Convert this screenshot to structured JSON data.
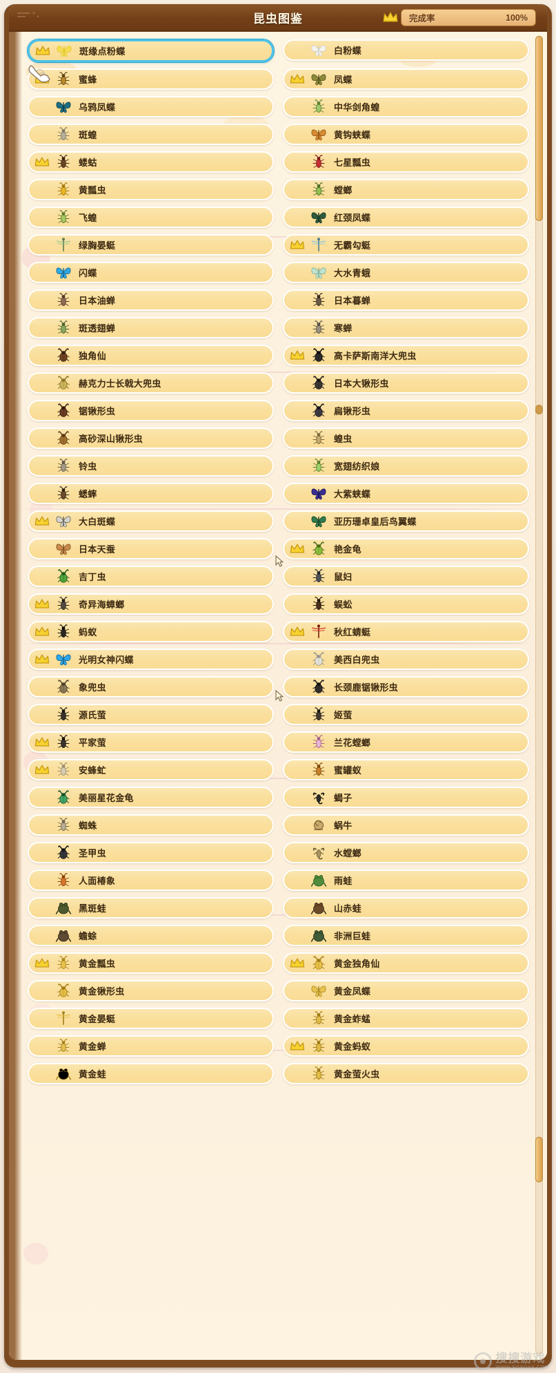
{
  "header": {
    "title": "昆虫图鉴",
    "crown_icon": "crown-icon",
    "completion_label": "完成率",
    "completion_value": "100%"
  },
  "scrollbar": {
    "name": "vertical-scrollbar"
  },
  "watermark": {
    "main": "搜搜游戏",
    "sub": "WWW.SOSOYX.COM"
  },
  "colors": {
    "frame_wood": "#7c4a21",
    "titlebar": "#733f18",
    "row_fill": "#fadf9c",
    "row_border": "#ffffff",
    "selected_outline": "#4fc3e8",
    "crown_gold": "#f5d02e",
    "text": "#3d2a12",
    "pill_fill": "#eeba7c"
  },
  "list": {
    "name": "insect-encyclopedia-list",
    "columns": 2,
    "items": [
      {
        "name": "斑缘点粉蝶",
        "crown": true,
        "selected": true,
        "icon": "butterfly-yellow",
        "col": 0
      },
      {
        "name": "白粉蝶",
        "crown": false,
        "selected": false,
        "icon": "butterfly-white",
        "col": 1
      },
      {
        "name": "蜜蜂",
        "crown": true,
        "selected": false,
        "icon": "bee",
        "col": 0
      },
      {
        "name": "凤蝶",
        "crown": true,
        "selected": false,
        "icon": "butterfly-olive",
        "col": 1
      },
      {
        "name": "乌鸦凤蝶",
        "crown": false,
        "selected": false,
        "icon": "butterfly-teal",
        "col": 0
      },
      {
        "name": "中华剑角蝗",
        "crown": false,
        "selected": false,
        "icon": "grasshopper-green",
        "col": 1
      },
      {
        "name": "斑蝗",
        "crown": false,
        "selected": false,
        "icon": "grasshopper-grey",
        "col": 0
      },
      {
        "name": "黄钩蛱蝶",
        "crown": false,
        "selected": false,
        "icon": "butterfly-orange",
        "col": 1
      },
      {
        "name": "蝼蛄",
        "crown": true,
        "selected": false,
        "icon": "mole-cricket",
        "col": 0
      },
      {
        "name": "七星瓢虫",
        "crown": false,
        "selected": false,
        "icon": "ladybug-red",
        "col": 1
      },
      {
        "name": "黄瓢虫",
        "crown": false,
        "selected": false,
        "icon": "ladybug-yellow",
        "col": 0
      },
      {
        "name": "螳螂",
        "crown": false,
        "selected": false,
        "icon": "mantis-green",
        "col": 1
      },
      {
        "name": "飞蝗",
        "crown": false,
        "selected": false,
        "icon": "locust-green",
        "col": 0
      },
      {
        "name": "红颈凤蝶",
        "crown": false,
        "selected": false,
        "icon": "butterfly-darkgreen",
        "col": 1
      },
      {
        "name": "绿胸晏蜓",
        "crown": false,
        "selected": false,
        "icon": "dragonfly-green",
        "col": 0
      },
      {
        "name": "无霸勾蜓",
        "crown": true,
        "selected": false,
        "icon": "dragonfly-blue",
        "col": 1
      },
      {
        "name": "闪蝶",
        "crown": false,
        "selected": false,
        "icon": "morpho-blue",
        "col": 0
      },
      {
        "name": "大水青蛾",
        "crown": false,
        "selected": false,
        "icon": "moth-pale-green",
        "col": 1
      },
      {
        "name": "日本油蝉",
        "crown": false,
        "selected": false,
        "icon": "cicada-brown",
        "col": 0
      },
      {
        "name": "日本暮蝉",
        "crown": false,
        "selected": false,
        "icon": "cicada-dark",
        "col": 1
      },
      {
        "name": "斑透翅蝉",
        "crown": false,
        "selected": false,
        "icon": "cicada-green",
        "col": 0
      },
      {
        "name": "寒蝉",
        "crown": false,
        "selected": false,
        "icon": "cicada-grey",
        "col": 1
      },
      {
        "name": "独角仙",
        "crown": false,
        "selected": false,
        "icon": "rhino-beetle",
        "col": 0
      },
      {
        "name": "高卡萨斯南洋大兜虫",
        "crown": true,
        "selected": false,
        "icon": "atlas-beetle",
        "col": 1
      },
      {
        "name": "赫克力士长戟大兜虫",
        "crown": false,
        "selected": false,
        "icon": "hercules-beetle",
        "col": 0
      },
      {
        "name": "日本大锹形虫",
        "crown": false,
        "selected": false,
        "icon": "stag-beetle-dark",
        "col": 1
      },
      {
        "name": "锯锹形虫",
        "crown": false,
        "selected": false,
        "icon": "saw-stag-beetle",
        "col": 0
      },
      {
        "name": "扁锹形虫",
        "crown": false,
        "selected": false,
        "icon": "flat-stag-beetle",
        "col": 1
      },
      {
        "name": "高砂深山锹形虫",
        "crown": false,
        "selected": false,
        "icon": "miyama-stag",
        "col": 0
      },
      {
        "name": "蝗虫",
        "crown": false,
        "selected": false,
        "icon": "locust-tan",
        "col": 1
      },
      {
        "name": "铃虫",
        "crown": false,
        "selected": false,
        "icon": "bell-cricket",
        "col": 0
      },
      {
        "name": "宽翅纺织娘",
        "crown": false,
        "selected": false,
        "icon": "katydid-green",
        "col": 1
      },
      {
        "name": "蟋蟀",
        "crown": false,
        "selected": false,
        "icon": "cricket-brown",
        "col": 0
      },
      {
        "name": "大紫蛱蝶",
        "crown": false,
        "selected": false,
        "icon": "butterfly-purple",
        "col": 1
      },
      {
        "name": "大白斑蝶",
        "crown": true,
        "selected": false,
        "icon": "butterfly-speckled",
        "col": 0
      },
      {
        "name": "亚历珊卓皇后鸟翼蝶",
        "crown": false,
        "selected": false,
        "icon": "birdwing-green",
        "col": 1
      },
      {
        "name": "日本天蚕",
        "crown": false,
        "selected": false,
        "icon": "moth-tan",
        "col": 0
      },
      {
        "name": "艳金龟",
        "crown": true,
        "selected": false,
        "icon": "scarab-green",
        "col": 1
      },
      {
        "name": "吉丁虫",
        "crown": false,
        "selected": false,
        "icon": "jewel-beetle",
        "col": 0
      },
      {
        "name": "鼠妇",
        "crown": false,
        "selected": false,
        "icon": "pillbug",
        "col": 1
      },
      {
        "name": "奇异海蟑螂",
        "crown": true,
        "selected": false,
        "icon": "sea-roach",
        "col": 0
      },
      {
        "name": "蜈蚣",
        "crown": false,
        "selected": false,
        "icon": "centipede",
        "col": 1
      },
      {
        "name": "蚂蚁",
        "crown": true,
        "selected": false,
        "icon": "ant-black",
        "col": 0
      },
      {
        "name": "秋红蜻蜓",
        "crown": true,
        "selected": false,
        "icon": "dragonfly-red",
        "col": 1
      },
      {
        "name": "光明女神闪蝶",
        "crown": true,
        "selected": false,
        "icon": "morpho-cyan",
        "col": 0
      },
      {
        "name": "美西白兜虫",
        "crown": false,
        "selected": false,
        "icon": "white-beetle",
        "col": 1
      },
      {
        "name": "象兜虫",
        "crown": false,
        "selected": false,
        "icon": "elephant-beetle",
        "col": 0
      },
      {
        "name": "长颈鹿锯锹形虫",
        "crown": false,
        "selected": false,
        "icon": "giraffe-stag",
        "col": 1
      },
      {
        "name": "源氏萤",
        "crown": false,
        "selected": false,
        "icon": "firefly-genji",
        "col": 0
      },
      {
        "name": "姬萤",
        "crown": false,
        "selected": false,
        "icon": "firefly-hime",
        "col": 1
      },
      {
        "name": "平家萤",
        "crown": true,
        "selected": false,
        "icon": "firefly-heike",
        "col": 0
      },
      {
        "name": "兰花螳螂",
        "crown": false,
        "selected": false,
        "icon": "orchid-mantis",
        "col": 1
      },
      {
        "name": "安蜂虻",
        "crown": true,
        "selected": false,
        "icon": "bee-fly",
        "col": 0
      },
      {
        "name": "蜜罐蚁",
        "crown": false,
        "selected": false,
        "icon": "honeypot-ant",
        "col": 1
      },
      {
        "name": "美丽星花金龟",
        "crown": false,
        "selected": false,
        "icon": "flower-scarab",
        "col": 0
      },
      {
        "name": "蝎子",
        "crown": false,
        "selected": false,
        "icon": "scorpion",
        "col": 1
      },
      {
        "name": "蜘蛛",
        "crown": false,
        "selected": false,
        "icon": "spider",
        "col": 0
      },
      {
        "name": "蜗牛",
        "crown": false,
        "selected": false,
        "icon": "snail",
        "col": 1
      },
      {
        "name": "圣甲虫",
        "crown": false,
        "selected": false,
        "icon": "dung-beetle",
        "col": 0
      },
      {
        "name": "水螳螂",
        "crown": false,
        "selected": false,
        "icon": "water-scorpion",
        "col": 1
      },
      {
        "name": "人面椿象",
        "crown": false,
        "selected": false,
        "icon": "man-faced-bug",
        "col": 0
      },
      {
        "name": "雨蛙",
        "crown": false,
        "selected": false,
        "icon": "tree-frog",
        "col": 1
      },
      {
        "name": "黑斑蛙",
        "crown": false,
        "selected": false,
        "icon": "pond-frog",
        "col": 0
      },
      {
        "name": "山赤蛙",
        "crown": false,
        "selected": false,
        "icon": "mountain-frog",
        "col": 1
      },
      {
        "name": "蟾蜍",
        "crown": false,
        "selected": false,
        "icon": "toad",
        "col": 0
      },
      {
        "name": "非洲巨蛙",
        "crown": false,
        "selected": false,
        "icon": "goliath-frog",
        "col": 1
      },
      {
        "name": "黄金瓢虫",
        "crown": true,
        "selected": false,
        "icon": "golden-ladybug",
        "col": 0
      },
      {
        "name": "黄金独角仙",
        "crown": true,
        "selected": false,
        "icon": "golden-rhino-beetle",
        "col": 1
      },
      {
        "name": "黄金锹形虫",
        "crown": false,
        "selected": false,
        "icon": "golden-stag-beetle",
        "col": 0
      },
      {
        "name": "黄金凤蝶",
        "crown": false,
        "selected": false,
        "icon": "golden-butterfly",
        "col": 1
      },
      {
        "name": "黄金晏蜓",
        "crown": false,
        "selected": false,
        "icon": "golden-dragonfly",
        "col": 0
      },
      {
        "name": "黄金蚱蜢",
        "crown": false,
        "selected": false,
        "icon": "golden-grasshopper",
        "col": 1
      },
      {
        "name": "黄金蝉",
        "crown": false,
        "selected": false,
        "icon": "golden-cicada",
        "col": 0
      },
      {
        "name": "黄金蚂蚁",
        "crown": true,
        "selected": false,
        "icon": "golden-ant",
        "col": 1
      },
      {
        "name": "黄金蛙",
        "crown": false,
        "selected": false,
        "icon": "golden-frog",
        "col": 0
      },
      {
        "name": "黄金萤火虫",
        "crown": false,
        "selected": false,
        "icon": "golden-firefly",
        "col": 1
      }
    ]
  }
}
